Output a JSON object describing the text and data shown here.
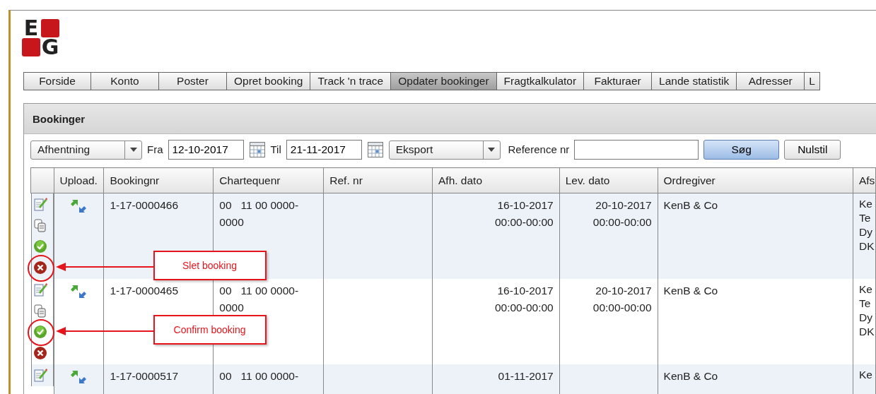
{
  "logo": {
    "letters": [
      "E",
      "G"
    ]
  },
  "tabs": [
    {
      "label": "Forside",
      "selected": false
    },
    {
      "label": "Konto",
      "selected": false
    },
    {
      "label": "Poster",
      "selected": false
    },
    {
      "label": "Opret booking",
      "selected": false
    },
    {
      "label": "Track 'n trace",
      "selected": false
    },
    {
      "label": "Opdater bookinger",
      "selected": true
    },
    {
      "label": "Fragtkalkulator",
      "selected": false
    },
    {
      "label": "Fakturaer",
      "selected": false
    },
    {
      "label": "Lande statistik",
      "selected": false
    },
    {
      "label": "Adresser",
      "selected": false
    },
    {
      "label": "L",
      "selected": false
    }
  ],
  "panel": {
    "title": "Bookinger",
    "filters": {
      "date_type": "Afhentning",
      "from_label": "Fra",
      "from_value": "12-10-2017",
      "to_label": "Til",
      "to_value": "21-11-2017",
      "direction": "Eksport",
      "reference_label": "Reference nr",
      "search_button": "Søg",
      "reset_button": "Nulstil"
    },
    "table": {
      "columns": [
        "Upload.",
        "Bookingnr",
        "Chartequenr",
        "Ref. nr",
        "Afh. dato",
        "Lev. dato",
        "Ordregiver",
        "Afs"
      ],
      "rows": [
        {
          "actions": [
            {
              "kind": "edit",
              "highlighted": false
            },
            {
              "kind": "copy",
              "highlighted": false
            },
            {
              "kind": "confirm",
              "highlighted": false
            },
            {
              "kind": "delete",
              "highlighted": true,
              "callout": "Slet booking"
            }
          ],
          "bookingnr": "1-17-0000466",
          "chartequenr": "00   11 00 0000-0000",
          "afh_dato": [
            "16-10-2017",
            "00:00-00:00"
          ],
          "lev_dato": [
            "20-10-2017",
            "00:00-00:00"
          ],
          "ordregiver": "KenB & Co",
          "afsender": [
            "Ke",
            "Te",
            "Dy",
            "DK"
          ]
        },
        {
          "actions": [
            {
              "kind": "edit",
              "highlighted": false
            },
            {
              "kind": "copy",
              "highlighted": false
            },
            {
              "kind": "confirm",
              "highlighted": true,
              "callout": "Confirm booking"
            },
            {
              "kind": "delete",
              "highlighted": false
            }
          ],
          "bookingnr": "1-17-0000465",
          "chartequenr": "00   11 00 0000-0000",
          "afh_dato": [
            "16-10-2017",
            "00:00-00:00"
          ],
          "lev_dato": [
            "20-10-2017",
            "00:00-00:00"
          ],
          "ordregiver": "KenB & Co",
          "afsender": [
            "Ke",
            "Te",
            "Dy",
            "DK"
          ]
        },
        {
          "actions": [
            {
              "kind": "edit",
              "highlighted": false
            }
          ],
          "bookingnr": "1-17-0000517",
          "chartequenr": "00   11 00 0000-",
          "afh_dato": [
            "01-11-2017"
          ],
          "ordregiver": "KenB & Co",
          "afsender": [
            "Ke"
          ]
        }
      ]
    }
  }
}
